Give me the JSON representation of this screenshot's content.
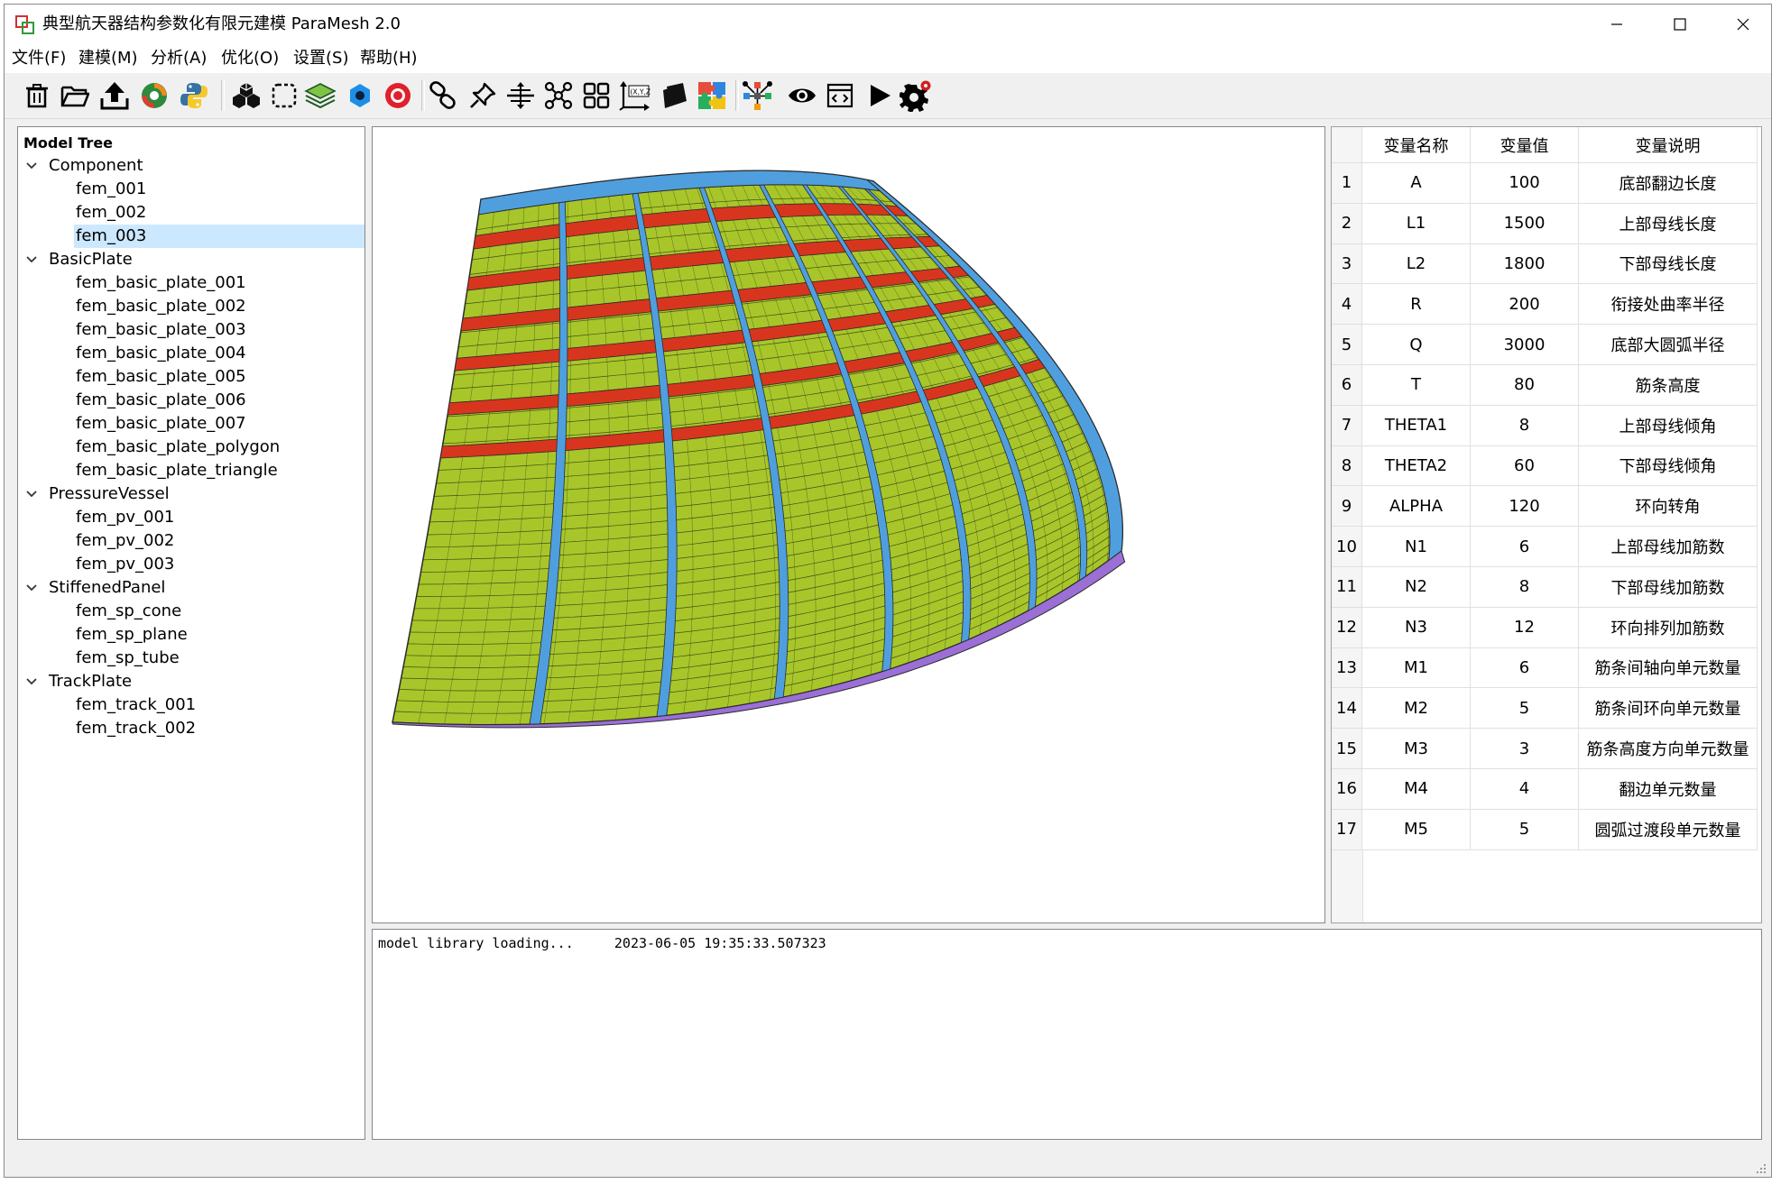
{
  "window": {
    "title": "典型航天器结构参数化有限元建模 ParaMesh 2.0",
    "icon": "app-logo-icon",
    "controls": [
      "minimize-icon",
      "maximize-icon",
      "close-icon"
    ]
  },
  "menu": [
    "文件(F)",
    "建模(M)",
    "分析(A)",
    "优化(O)",
    "设置(S)",
    "帮助(H)"
  ],
  "toolbar": {
    "icons": [
      "trash-icon",
      "folder-open-icon",
      "upload-icon",
      "refresh-icon",
      "python-icon",
      "cubes-icon",
      "dashed-select-icon",
      "layers-icon",
      "hexagon-icon",
      "record-icon",
      "link-icon",
      "pin-icon",
      "split-icon",
      "node-graph-icon",
      "grid-icon",
      "xyz-axis-icon",
      "note-icon",
      "plugin-icon",
      "network-icon",
      "eye-icon",
      "code-window-icon",
      "play-icon",
      "settings-icon"
    ]
  },
  "tree": {
    "header": "Model Tree",
    "groups": [
      {
        "label": "Component",
        "children": [
          "fem_001",
          "fem_002",
          "fem_003"
        ]
      },
      {
        "label": "BasicPlate",
        "children": [
          "fem_basic_plate_001",
          "fem_basic_plate_002",
          "fem_basic_plate_003",
          "fem_basic_plate_004",
          "fem_basic_plate_005",
          "fem_basic_plate_006",
          "fem_basic_plate_007",
          "fem_basic_plate_polygon",
          "fem_basic_plate_triangle"
        ]
      },
      {
        "label": "PressureVessel",
        "children": [
          "fem_pv_001",
          "fem_pv_002",
          "fem_pv_003"
        ]
      },
      {
        "label": "StiffenedPanel",
        "children": [
          "fem_sp_cone",
          "fem_sp_plane",
          "fem_sp_tube"
        ]
      },
      {
        "label": "TrackPlate",
        "children": [
          "fem_track_001",
          "fem_track_002"
        ]
      }
    ],
    "selected": "fem_003"
  },
  "viewport": {
    "colors": {
      "shell": "#a8c62a",
      "rib": "#4f9fdf",
      "ring": "#d8351f",
      "flange": "#9b6fd6",
      "edge": "#2a2a2a",
      "mesh": "#1e2a12"
    }
  },
  "table": {
    "headers": [
      "变量名称",
      "变量值",
      "变量说明"
    ],
    "rows": [
      {
        "no": "1",
        "name": "A",
        "value": "100",
        "desc": "底部翻边长度"
      },
      {
        "no": "2",
        "name": "L1",
        "value": "1500",
        "desc": "上部母线长度"
      },
      {
        "no": "3",
        "name": "L2",
        "value": "1800",
        "desc": "下部母线长度"
      },
      {
        "no": "4",
        "name": "R",
        "value": "200",
        "desc": "衔接处曲率半径"
      },
      {
        "no": "5",
        "name": "Q",
        "value": "3000",
        "desc": "底部大圆弧半径"
      },
      {
        "no": "6",
        "name": "T",
        "value": "80",
        "desc": "筋条高度"
      },
      {
        "no": "7",
        "name": "THETA1",
        "value": "8",
        "desc": "上部母线倾角"
      },
      {
        "no": "8",
        "name": "THETA2",
        "value": "60",
        "desc": "下部母线倾角"
      },
      {
        "no": "9",
        "name": "ALPHA",
        "value": "120",
        "desc": "环向转角"
      },
      {
        "no": "10",
        "name": "N1",
        "value": "6",
        "desc": "上部母线加筋数"
      },
      {
        "no": "11",
        "name": "N2",
        "value": "8",
        "desc": "下部母线加筋数"
      },
      {
        "no": "12",
        "name": "N3",
        "value": "12",
        "desc": "环向排列加筋数"
      },
      {
        "no": "13",
        "name": "M1",
        "value": "6",
        "desc": "筋条间轴向单元数量"
      },
      {
        "no": "14",
        "name": "M2",
        "value": "5",
        "desc": "筋条间环向单元数量"
      },
      {
        "no": "15",
        "name": "M3",
        "value": "3",
        "desc": "筋条高度方向单元数量"
      },
      {
        "no": "16",
        "name": "M4",
        "value": "4",
        "desc": "翻边单元数量"
      },
      {
        "no": "17",
        "name": "M5",
        "value": "5",
        "desc": "圆弧过渡段单元数量"
      }
    ]
  },
  "log": {
    "message": "model library loading...",
    "timestamp": "2023-06-05 19:35:33.507323"
  }
}
